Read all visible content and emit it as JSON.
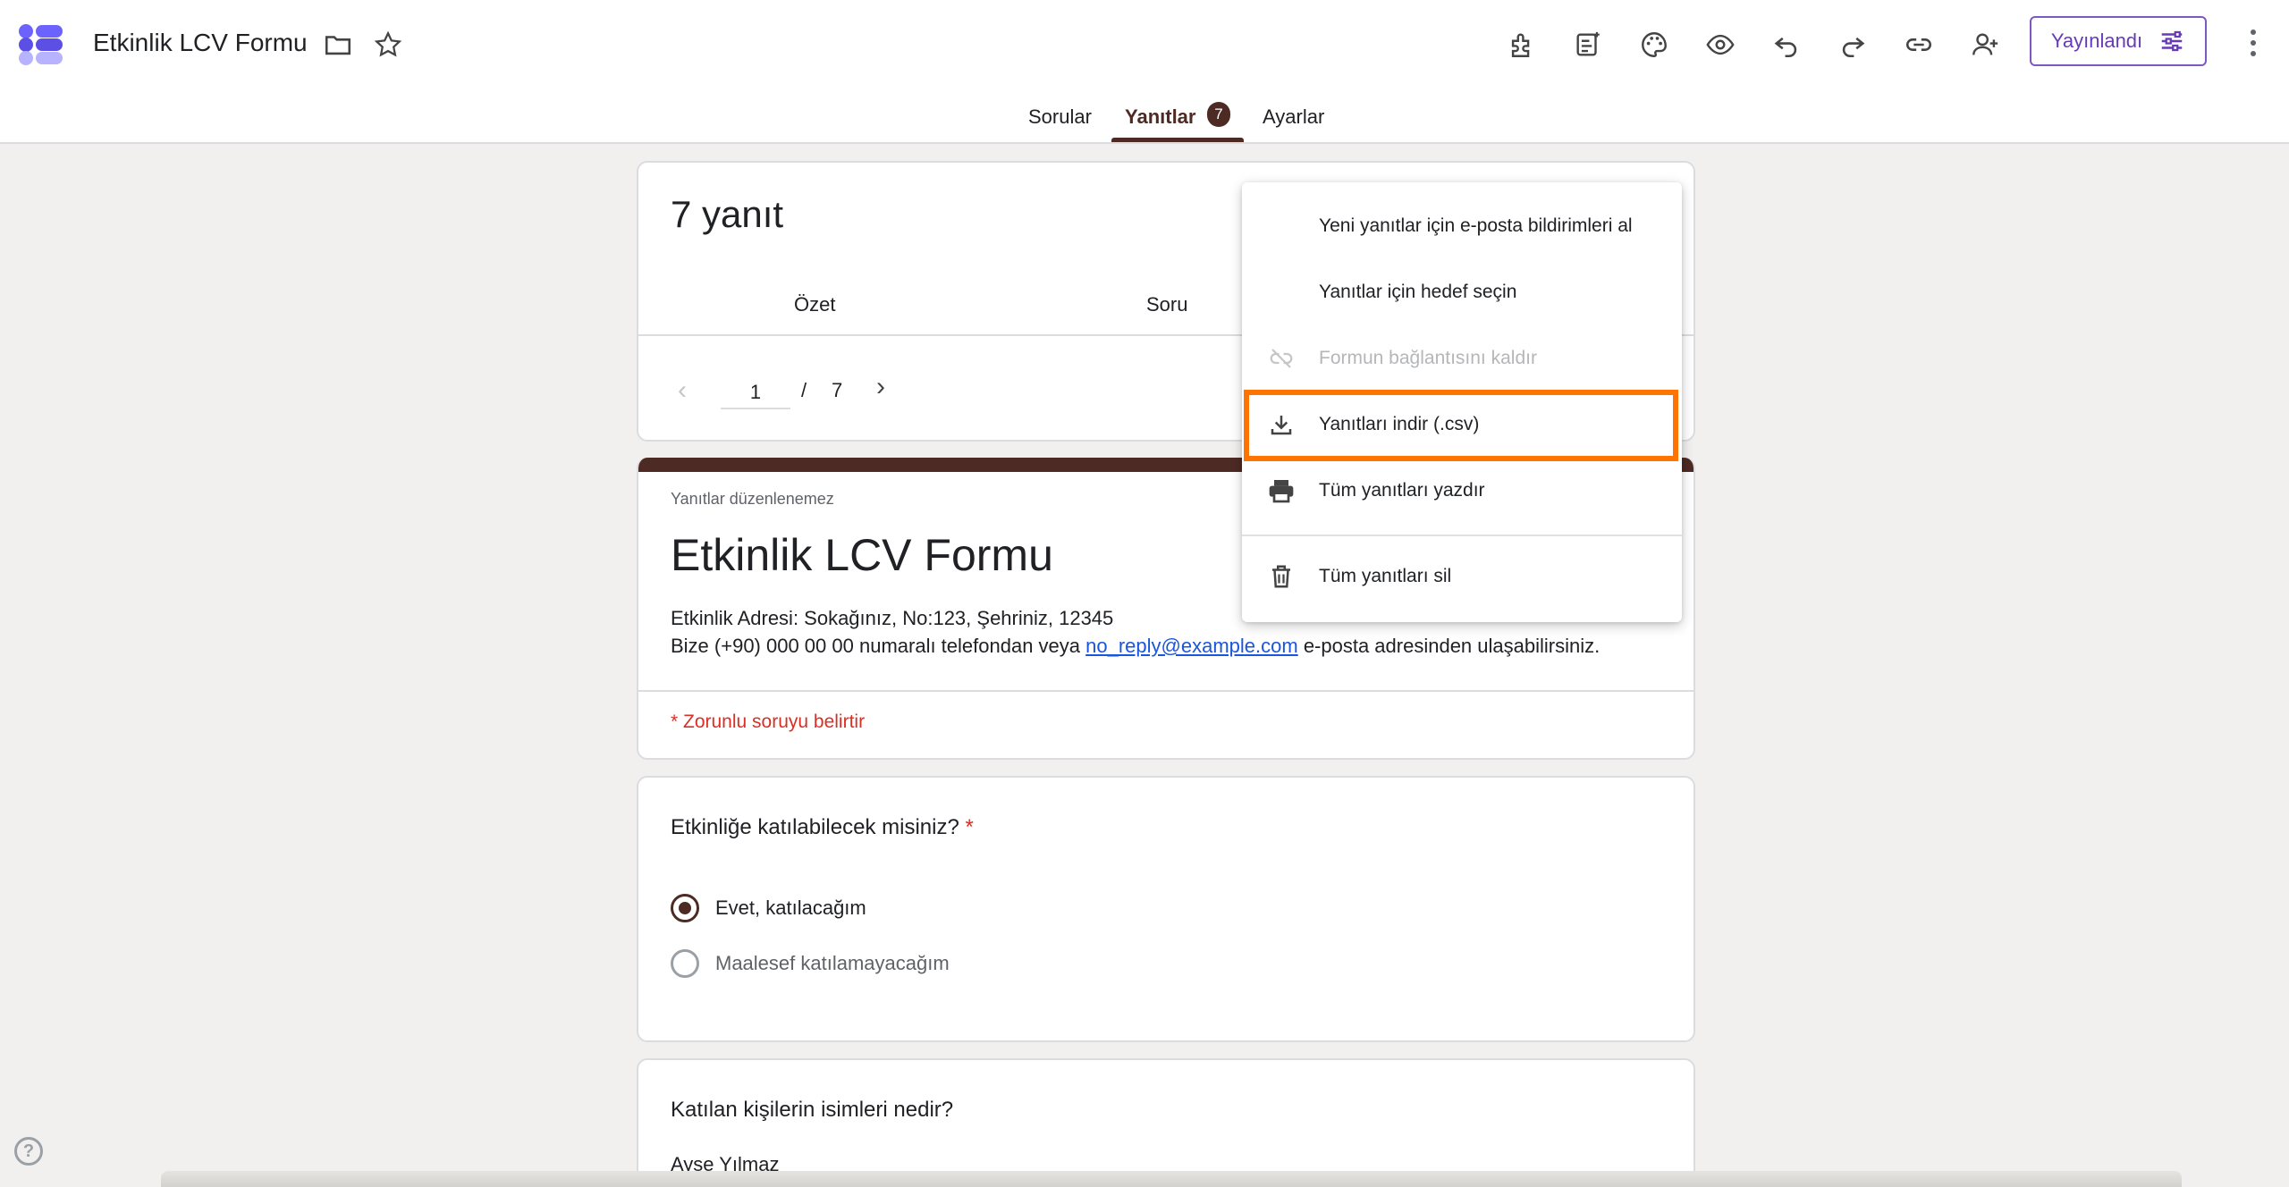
{
  "app": {
    "doc_title": "Etkinlik LCV Formu",
    "publish_label": "Yayınlandı"
  },
  "tabs": [
    {
      "label": "Sorular"
    },
    {
      "label": "Yanıtlar",
      "badge": "7"
    },
    {
      "label": "Ayarlar"
    }
  ],
  "responses": {
    "count_label": "7 yanıt",
    "subtabs": [
      "Özet",
      "Soru"
    ],
    "pager_current": "1",
    "pager_sep": "/",
    "pager_total": "7"
  },
  "form": {
    "cant_edit": "Yanıtlar düzenlenemez",
    "title": "Etkinlik LCV Formu",
    "desc_line1": "Etkinlik Adresi: Sokağınız, No:123, Şehriniz, 12345",
    "desc_line2_prefix": "Bize (+90) 000 00 00 numaralı telefondan veya ",
    "desc_link": "no_reply@example.com",
    "desc_line2_suffix": " e-posta adresinden ulaşabilirsiniz.",
    "required_note": "* Zorunlu soruyu belirtir"
  },
  "question1": {
    "title": "Etkinliğe katılabilecek misiniz?",
    "required_mark": "*",
    "options": [
      "Evet, katılacağım",
      "Maalesef katılamayacağım"
    ],
    "selected_index": 0
  },
  "question2": {
    "title": "Katılan kişilerin isimleri nedir?",
    "answer": "Ayşe Yılmaz"
  },
  "menu": {
    "items": [
      {
        "label": "Yeni yanıtlar için e-posta bildirimleri al",
        "icon": "none"
      },
      {
        "label": "Yanıtlar için hedef seçin",
        "icon": "none"
      },
      {
        "label": "Formun bağlantısını kaldır",
        "icon": "unlink-icon",
        "disabled": true
      },
      {
        "label": "Yanıtları indir (.csv)",
        "icon": "download-icon",
        "highlighted": true
      },
      {
        "label": "Tüm yanıtları yazdır",
        "icon": "print-icon"
      },
      {
        "label": "Tüm yanıtları sil",
        "icon": "trash-icon"
      }
    ]
  },
  "colors": {
    "theme": "#4e2a24",
    "publish_accent": "#673ab7",
    "highlight": "#ff7400",
    "required": "#d93025"
  }
}
